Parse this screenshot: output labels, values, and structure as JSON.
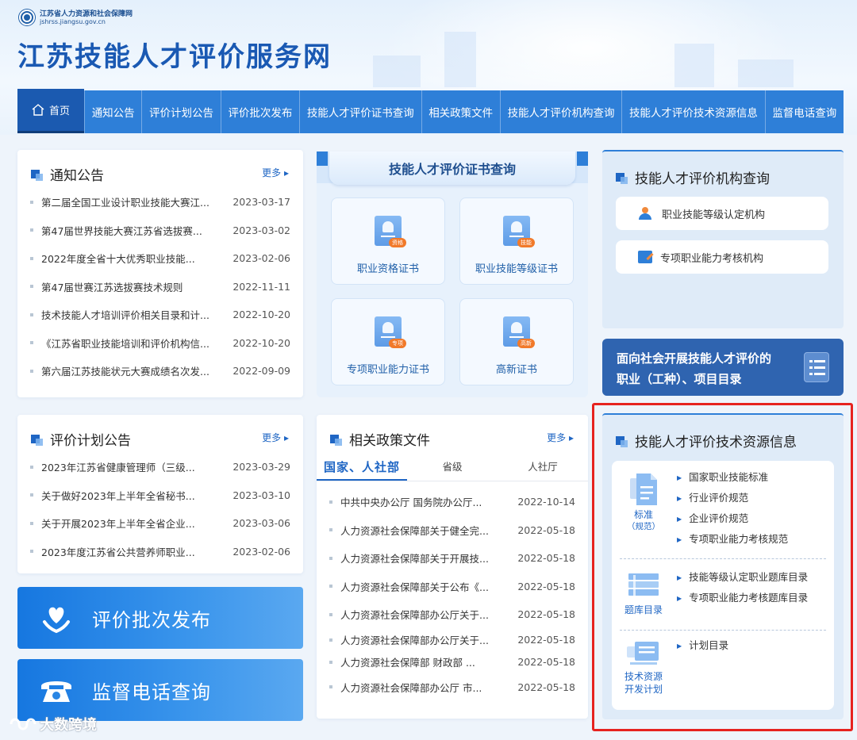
{
  "header": {
    "org_name": "江苏省人力资源和社会保障网",
    "org_url": "jshrss.jiangsu.gov.cn",
    "site_title": "江苏技能人才评价服务网"
  },
  "nav": {
    "home": "首页",
    "items": [
      "通知公告",
      "评价计划公告",
      "评价批次发布",
      "技能人才评价证书查询",
      "相关政策文件",
      "技能人才评价机构查询",
      "技能人才评价技术资源信息",
      "监督电话查询"
    ]
  },
  "notices": {
    "title": "通知公告",
    "more": "更多",
    "items": [
      {
        "text": "第二届全国工业设计职业技能大赛江...",
        "date": "2023-03-17"
      },
      {
        "text": "第47届世界技能大赛江苏省选拔赛...",
        "date": "2023-03-02"
      },
      {
        "text": "2022年度全省十大优秀职业技能...",
        "date": "2023-02-06"
      },
      {
        "text": "第47届世赛江苏选拔赛技术规则",
        "date": "2022-11-11"
      },
      {
        "text": "技术技能人才培训评价相关目录和计...",
        "date": "2022-10-20"
      },
      {
        "text": "《江苏省职业技能培训和评价机构信...",
        "date": "2022-10-20"
      },
      {
        "text": "第六届江苏技能状元大赛成绩名次发...",
        "date": "2022-09-09"
      }
    ]
  },
  "plans": {
    "title": "评价计划公告",
    "more": "更多",
    "items": [
      {
        "text": "2023年江苏省健康管理师（三级...",
        "date": "2023-03-29"
      },
      {
        "text": "关于做好2023年上半年全省秘书...",
        "date": "2023-03-10"
      },
      {
        "text": "关于开展2023年上半年全省企业...",
        "date": "2023-03-06"
      },
      {
        "text": "2023年度江苏省公共营养师职业...",
        "date": "2023-02-06"
      }
    ]
  },
  "cert": {
    "title": "技能人才评价证书查询",
    "tiles": [
      {
        "label": "职业资格证书",
        "tag": "资格"
      },
      {
        "label": "职业技能等级证书",
        "tag": "技能"
      },
      {
        "label": "专项职业能力证书",
        "tag": "专项"
      },
      {
        "label": "高新证书",
        "tag": "高新"
      }
    ]
  },
  "org_query": {
    "title": "技能人才评价机构查询",
    "buttons": [
      "职业技能等级认定机构",
      "专项职业能力考核机构"
    ]
  },
  "catalog": {
    "line1": "面向社会开展技能人才评价的",
    "line2": "职业（工种）、项目目录"
  },
  "big_buttons": {
    "batch": "评价批次发布",
    "phone": "监督电话查询"
  },
  "policy": {
    "title": "相关政策文件",
    "more": "更多",
    "tabs": [
      "国家、人社部",
      "省级",
      "人社厅"
    ],
    "items": [
      {
        "text": "中共中央办公厅 国务院办公厅...",
        "date": "2022-10-14"
      },
      {
        "text": "人力资源社会保障部关于健全完...",
        "date": "2022-05-18"
      },
      {
        "text": "人力资源社会保障部关于开展技...",
        "date": "2022-05-18"
      },
      {
        "text": "人力资源社会保障部关于公布《...",
        "date": "2022-05-18"
      },
      {
        "text": "人力资源社会保障部办公厅关于...",
        "date": "2022-05-18"
      },
      {
        "text": "人力资源社会保障部办公厅关于...",
        "date": "2022-05-18"
      },
      {
        "text": "人力资源社会保障部 财政部 ...",
        "date": "2022-05-18"
      },
      {
        "text": "人力资源社会保障部办公厅 市...",
        "date": "2022-05-18"
      }
    ]
  },
  "resources": {
    "title": "技能人才评价技术资源信息",
    "sections": [
      {
        "label": "标准",
        "sub": "（规范）",
        "links": [
          "国家职业技能标准",
          "行业评价规范",
          "企业评价规范",
          "专项职业能力考核规范"
        ]
      },
      {
        "label": "题库目录",
        "sub": "",
        "links": [
          "技能等级认定职业题库目录",
          "专项职业能力考核题库目录"
        ]
      },
      {
        "label": "技术资源",
        "sub": "开发计划",
        "links": [
          "计划目录"
        ]
      }
    ]
  },
  "watermark": "大数跨境",
  "colors": {
    "brand": "#1a59b3",
    "nav": "#2e7fd8",
    "highlight": "#e6231f",
    "tag": "#f17a2a"
  }
}
